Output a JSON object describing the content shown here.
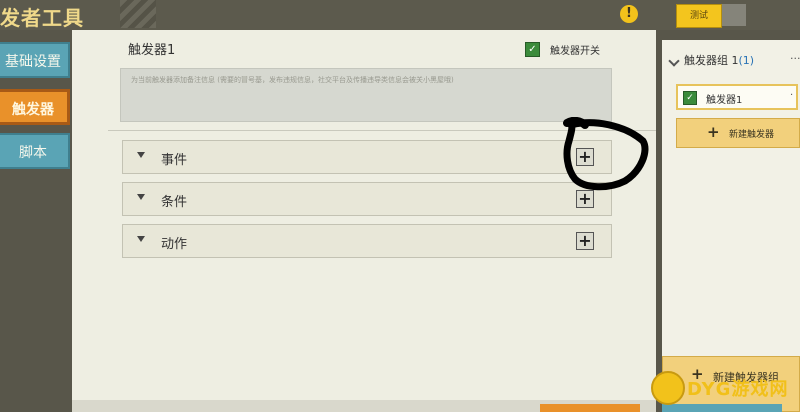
{
  "app": {
    "title": "发者工具"
  },
  "header": {
    "test_label": "测试",
    "warning_symbol": "!"
  },
  "nav": {
    "items": [
      {
        "label": "基础设置"
      },
      {
        "label": "触发器"
      },
      {
        "label": "脚本"
      }
    ]
  },
  "main": {
    "title": "触发器1",
    "enable_label": "触发器开关",
    "enabled": true,
    "note_placeholder": "为当前触发器添加备注信息 (需要的冒号基，发布违规信息，社交平台及传播违导类信息会被关小黑屋哦)",
    "sections": [
      {
        "label": "事件",
        "add": "+"
      },
      {
        "label": "条件",
        "add": "+"
      },
      {
        "label": "动作",
        "add": "+"
      }
    ]
  },
  "right": {
    "group_label": "触发器组 1",
    "group_count": "(1)",
    "group_more": "···",
    "rule_label": "触发器1",
    "rule_more": "·",
    "new_trigger_label": "新建触发器",
    "new_group_label": "新建触发器组",
    "plus": "+"
  },
  "watermark": {
    "text": "DYG游戏网"
  },
  "colors": {
    "accent_orange": "#e9912a",
    "nav_teal": "#5aa4b5",
    "highlight_yellow": "#f2d07c",
    "check_green": "#3b8b3b"
  }
}
